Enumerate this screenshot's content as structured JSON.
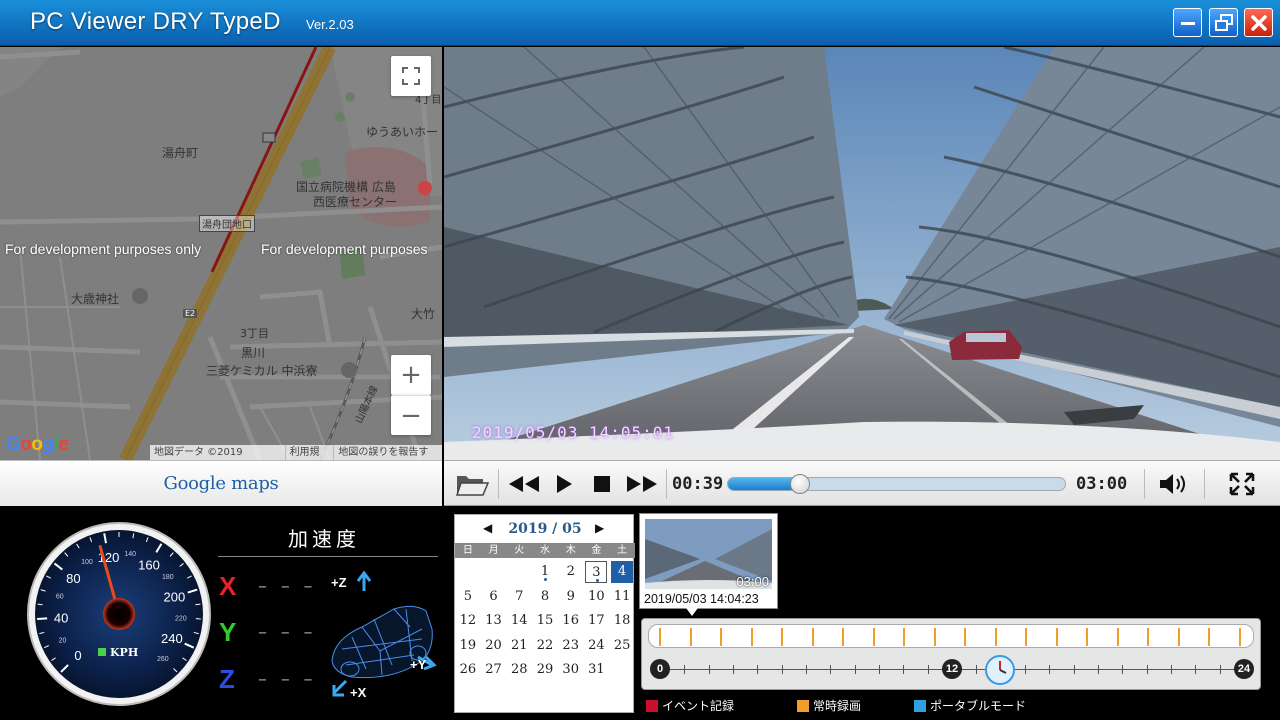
{
  "window": {
    "title": "PC Viewer DRY TypeD",
    "version": "Ver.2.03"
  },
  "map": {
    "labels": [
      "湯舟町",
      "湯舟団地口",
      "国立病院機構 広島",
      "西医療センター",
      "ゆうあいホー",
      "大歳神社",
      "3丁目",
      "黒川",
      "三菱ケミカル 中浜寮",
      "大竹",
      "4丁目",
      "山陽本線"
    ],
    "dev_note_left": "For development purposes only",
    "dev_note_right": "For development purposes",
    "credits": [
      "地図データ ©2019 Google",
      "利用規約",
      "地図の誤りを報告する"
    ],
    "google_logo": "Google",
    "route_label": "E2",
    "brand_bar": "Google maps",
    "zoom_in": "+",
    "zoom_out": "−"
  },
  "video": {
    "timestamp": "2019/05/03  14:05:01"
  },
  "player": {
    "current_time": "00:39",
    "total_time": "03:00",
    "progress_fraction": 0.2167
  },
  "accel": {
    "title": "加速度",
    "axes": [
      {
        "letter": "X",
        "value": "– – –",
        "color": "#e8202a"
      },
      {
        "letter": "Y",
        "value": "– – –",
        "color": "#2ecc2e"
      },
      {
        "letter": "Z",
        "value": "– – –",
        "color": "#2a4fe0"
      }
    ],
    "car_labels": [
      "+Z",
      "+Y",
      "+X"
    ]
  },
  "speedometer": {
    "unit": "KPH",
    "major_ticks": [
      "0",
      "40",
      "80",
      "120",
      "160",
      "200",
      "240"
    ],
    "minor_ticks": [
      "20",
      "60",
      "100",
      "140",
      "180",
      "220",
      "260"
    ],
    "needle_value": 115,
    "max_value": 260
  },
  "calendar": {
    "month_label": "2019 / 05",
    "weekdays": [
      "日",
      "月",
      "火",
      "水",
      "木",
      "金",
      "土"
    ],
    "days": [
      [
        "",
        "",
        "",
        "1",
        "2",
        "3",
        "4"
      ],
      [
        "5",
        "6",
        "7",
        "8",
        "9",
        "10",
        "11"
      ],
      [
        "12",
        "13",
        "14",
        "15",
        "16",
        "17",
        "18"
      ],
      [
        "19",
        "20",
        "21",
        "22",
        "23",
        "24",
        "25"
      ],
      [
        "26",
        "27",
        "28",
        "29",
        "30",
        "31",
        ""
      ]
    ],
    "today": "3",
    "selected": "4",
    "days_with_records": [
      "1",
      "3"
    ]
  },
  "thumbnail": {
    "duration": "03:00",
    "caption": "2019/05/03 14:04:23"
  },
  "timeline": {
    "labels": [
      "0",
      "12",
      "24"
    ],
    "clock_hour": 14
  },
  "legend": [
    {
      "label": "イベント記録",
      "color": "#c8102e"
    },
    {
      "label": "常時録画",
      "color": "#f29d2b"
    },
    {
      "label": "ポータブルモード",
      "color": "#2fa0e0"
    }
  ]
}
